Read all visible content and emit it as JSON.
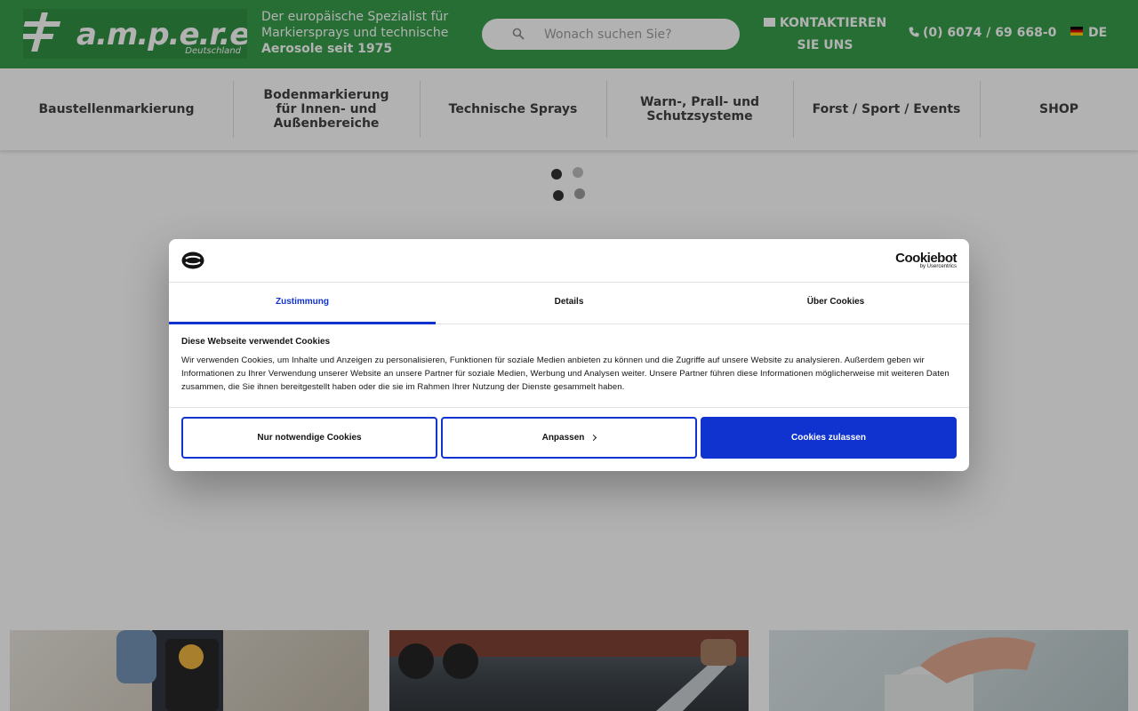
{
  "header": {
    "logo_text": "a.m.p.e.r.e.",
    "logo_sub": "Deutschland",
    "tagline_line1": "Der europäische Spezialist für",
    "tagline_line2": "Markiersprays und technische",
    "tagline_line3": "Aerosole seit 1975",
    "search_placeholder": "Wonach suchen Sie?",
    "contact_label": "KONTAKTIEREN SIE UNS",
    "phone": "(0) 6074 / 69 668-0",
    "language": "DE"
  },
  "nav": {
    "items": [
      {
        "label": "Baustellenmarkierung"
      },
      {
        "label": "Bodenmarkierung für Innen- und Außenbereiche"
      },
      {
        "label": "Technische Sprays"
      },
      {
        "label": "Warn-, Prall- und Schutzsysteme"
      },
      {
        "label": "Forst / Sport / Events"
      },
      {
        "label": "SHOP"
      }
    ]
  },
  "cookie_dialog": {
    "brand_name": "Cookiebot",
    "brand_sub": "by Usercentrics",
    "tabs": [
      {
        "label": "Zustimmung",
        "active": true
      },
      {
        "label": "Details",
        "active": false
      },
      {
        "label": "Über Cookies",
        "active": false
      }
    ],
    "heading": "Diese Webseite verwendet Cookies",
    "text": "Wir verwenden Cookies, um Inhalte und Anzeigen zu personalisieren, Funktionen für soziale Medien anbieten zu können und die Zugriffe auf unsere Website zu analysieren. Außerdem geben wir Informationen zu Ihrer Verwendung unserer Website an unsere Partner für soziale Medien, Werbung und Analysen weiter. Unsere Partner führen diese Informationen möglicherweise mit weiteren Daten zusammen, die Sie ihnen bereitgestellt haben oder die sie im Rahmen Ihrer Nutzung der Dienste gesammelt haben.",
    "buttons": {
      "necessary": "Nur notwendige Cookies",
      "customize": "Anpassen",
      "allow_all": "Cookies zulassen"
    }
  },
  "colors": {
    "header_green": "#2f9a43",
    "cookie_blue": "#1032cf"
  },
  "icons": {
    "search": "search-icon",
    "mail": "envelope-icon",
    "phone": "phone-icon",
    "flag": "flag-de-icon",
    "loader": "loading-dots-icon"
  }
}
